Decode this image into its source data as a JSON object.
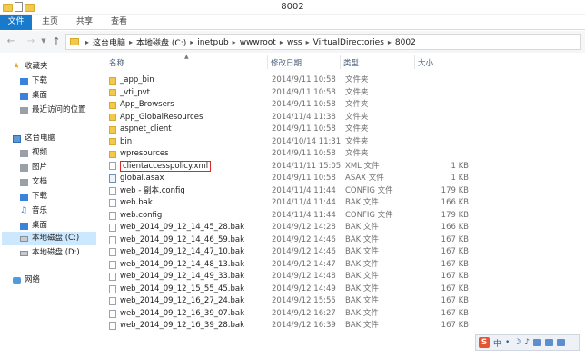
{
  "window": {
    "title": "8002"
  },
  "ribbon": {
    "tabs": [
      "文件",
      "主页",
      "共享",
      "查看"
    ]
  },
  "address": {
    "crumbs": [
      "这台电脑",
      "本地磁盘 (C:)",
      "inetpub",
      "wwwroot",
      "wss",
      "VirtualDirectories",
      "8002"
    ]
  },
  "nav": {
    "favorites_label": "收藏夹",
    "favorites": [
      "下载",
      "桌面",
      "最近访问的位置"
    ],
    "pc_label": "这台电脑",
    "pc_items": [
      "视频",
      "图片",
      "文档",
      "下载",
      "音乐",
      "桌面",
      "本地磁盘 (C:)",
      "本地磁盘 (D:)"
    ],
    "network_label": "网络"
  },
  "columns": {
    "name": "名称",
    "date": "修改日期",
    "type": "类型",
    "size": "大小"
  },
  "files": [
    {
      "name": "_app_bin",
      "date": "2014/9/11 10:58",
      "type": "文件夹",
      "size": "",
      "kind": "folder"
    },
    {
      "name": "_vti_pvt",
      "date": "2014/9/11 10:58",
      "type": "文件夹",
      "size": "",
      "kind": "folder"
    },
    {
      "name": "App_Browsers",
      "date": "2014/9/11 10:58",
      "type": "文件夹",
      "size": "",
      "kind": "folder"
    },
    {
      "name": "App_GlobalResources",
      "date": "2014/11/4 11:38",
      "type": "文件夹",
      "size": "",
      "kind": "folder"
    },
    {
      "name": "aspnet_client",
      "date": "2014/9/11 10:58",
      "type": "文件夹",
      "size": "",
      "kind": "folder"
    },
    {
      "name": "bin",
      "date": "2014/10/14 11:31",
      "type": "文件夹",
      "size": "",
      "kind": "folder"
    },
    {
      "name": "wpresources",
      "date": "2014/9/11 10:58",
      "type": "文件夹",
      "size": "",
      "kind": "folder"
    },
    {
      "name": "clientaccesspolicy.xml",
      "date": "2014/11/11 15:05",
      "type": "XML 文件",
      "size": "1 KB",
      "kind": "file",
      "highlight": true
    },
    {
      "name": "global.asax",
      "date": "2014/9/11 10:58",
      "type": "ASAX 文件",
      "size": "1 KB",
      "kind": "asax"
    },
    {
      "name": "web - 副本.config",
      "date": "2014/11/4 11:44",
      "type": "CONFIG 文件",
      "size": "179 KB",
      "kind": "file"
    },
    {
      "name": "web.bak",
      "date": "2014/11/4 11:44",
      "type": "BAK 文件",
      "size": "166 KB",
      "kind": "file"
    },
    {
      "name": "web.config",
      "date": "2014/11/4 11:44",
      "type": "CONFIG 文件",
      "size": "179 KB",
      "kind": "file"
    },
    {
      "name": "web_2014_09_12_14_45_28.bak",
      "date": "2014/9/12 14:28",
      "type": "BAK 文件",
      "size": "166 KB",
      "kind": "file"
    },
    {
      "name": "web_2014_09_12_14_46_59.bak",
      "date": "2014/9/12 14:46",
      "type": "BAK 文件",
      "size": "167 KB",
      "kind": "file"
    },
    {
      "name": "web_2014_09_12_14_47_10.bak",
      "date": "2014/9/12 14:46",
      "type": "BAK 文件",
      "size": "167 KB",
      "kind": "file"
    },
    {
      "name": "web_2014_09_12_14_48_13.bak",
      "date": "2014/9/12 14:47",
      "type": "BAK 文件",
      "size": "167 KB",
      "kind": "file"
    },
    {
      "name": "web_2014_09_12_14_49_33.bak",
      "date": "2014/9/12 14:48",
      "type": "BAK 文件",
      "size": "167 KB",
      "kind": "file"
    },
    {
      "name": "web_2014_09_12_15_55_45.bak",
      "date": "2014/9/12 14:49",
      "type": "BAK 文件",
      "size": "167 KB",
      "kind": "file"
    },
    {
      "name": "web_2014_09_12_16_27_24.bak",
      "date": "2014/9/12 15:55",
      "type": "BAK 文件",
      "size": "167 KB",
      "kind": "file"
    },
    {
      "name": "web_2014_09_12_16_39_07.bak",
      "date": "2014/9/12 16:27",
      "type": "BAK 文件",
      "size": "167 KB",
      "kind": "file"
    },
    {
      "name": "web_2014_09_12_16_39_28.bak",
      "date": "2014/9/12 16:39",
      "type": "BAK 文件",
      "size": "167 KB",
      "kind": "file"
    }
  ],
  "tray": {
    "ime_logo": "S",
    "ime_mode": "中"
  },
  "colors": {
    "file_tab": "#1979ca",
    "selection": "#cce8ff",
    "highlight_box": "#d8282a",
    "folder": "#f2c94c"
  }
}
